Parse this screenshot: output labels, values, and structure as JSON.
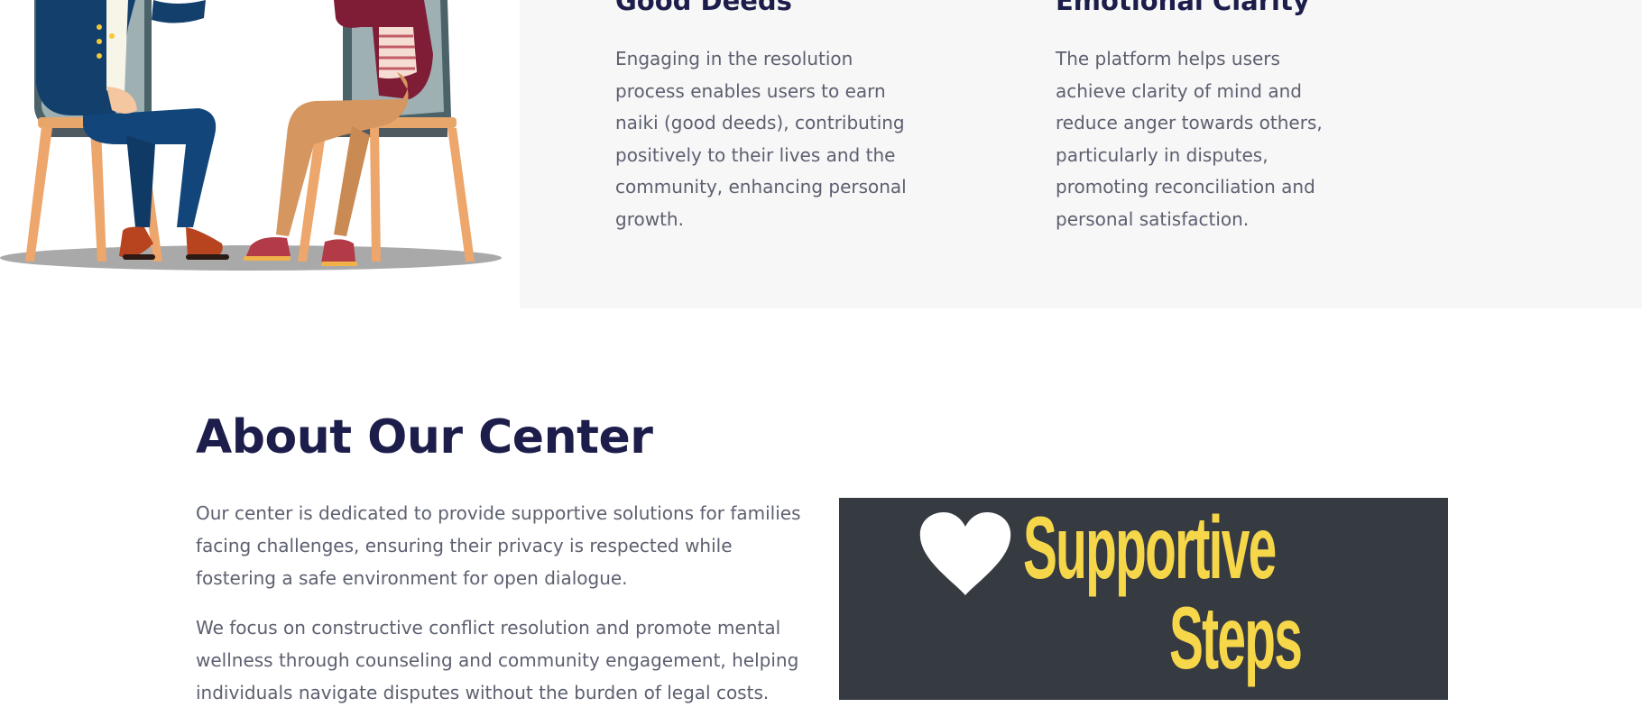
{
  "features": [
    {
      "title": "Good Deeds",
      "text": "Engaging in the resolution process enables users to earn naiki (good deeds), contributing positively to their lives and the community, enhancing personal growth."
    },
    {
      "title": "Emotional Clarity",
      "text": "The platform helps users achieve clarity of mind and reduce anger towards others, particularly in disputes, promoting reconciliation and personal satisfaction."
    }
  ],
  "about": {
    "title": "About Our Center",
    "paragraphs": [
      "Our center is dedicated to provide supportive solutions for families facing challenges, ensuring their privacy is respected while fostering a safe environment for open dialogue.",
      "We focus on constructive conflict resolution and promote mental wellness through counseling and community engagement, helping individuals navigate disputes without the burden of legal costs."
    ]
  },
  "logo": {
    "line1": "Supportive",
    "line2": "Steps",
    "icon": "heart-icon",
    "text_color": "#f7d74a",
    "background": "#363a41"
  },
  "colors": {
    "heading": "#1c1d4a",
    "body_text": "#5d6070",
    "panel_bg": "#f7f7f7"
  }
}
